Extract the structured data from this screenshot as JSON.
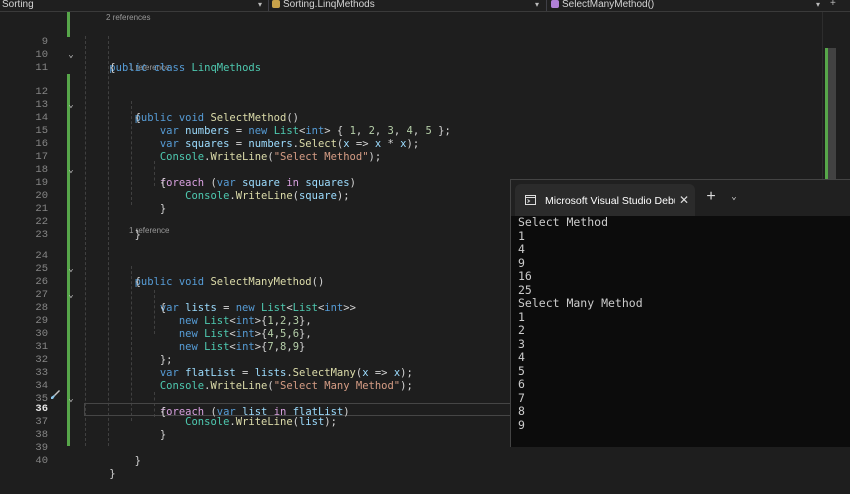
{
  "navbar": {
    "project": "Sorting",
    "class_path": "Sorting.LinqMethods",
    "member": "SelectManyMethod()"
  },
  "code_lens": {
    "class_refs": "2 references",
    "select_refs": "1 reference",
    "selectmany_refs": "1 reference"
  },
  "line_numbers": {
    "l9": "9",
    "l10": "10",
    "l11": "11",
    "l12": "12",
    "l13": "13",
    "l14": "14",
    "l15": "15",
    "l16": "16",
    "l17": "17",
    "l18": "18",
    "l19": "19",
    "l20": "20",
    "l21": "21",
    "l22": "22",
    "l23": "23",
    "l24": "24",
    "l25": "25",
    "l26": "26",
    "l27": "27",
    "l28": "28",
    "l29": "29",
    "l30": "30",
    "l31": "31",
    "l32": "32",
    "l33": "33",
    "l34": "34",
    "l35": "35",
    "l36": "36",
    "l37": "37",
    "l38": "38",
    "l39": "39",
    "l40": "40"
  },
  "code": {
    "public": "public",
    "class": "class",
    "static_void": "void",
    "var": "var",
    "new": "new",
    "foreach": "foreach",
    "in": "in",
    "class_name": "LinqMethods",
    "select_method": "SelectMethod",
    "selectmany_method": "SelectManyMethod",
    "list": "List",
    "int": "int",
    "console": "Console",
    "writeline": "WriteLine",
    "select": "Select",
    "selectmany": "SelectMany",
    "numbers": "numbers",
    "squares": "squares",
    "square": "square",
    "x": "x",
    "lists": "lists",
    "flatList": "flatList",
    "listvar": "list",
    "str_select": "\"Select Method\"",
    "str_selectmany": "\"Select Many Method\"",
    "n1": "1",
    "n2": "2",
    "n3": "3",
    "n4": "4",
    "n5": "5",
    "n6": "6",
    "n7": "7",
    "n8": "8",
    "n9": "9"
  },
  "console": {
    "title": "Microsoft Visual Studio Debug Console",
    "lines": [
      "Select Method",
      "1",
      "4",
      "9",
      "16",
      "25",
      "Select Many Method",
      "1",
      "2",
      "3",
      "4",
      "5",
      "6",
      "7",
      "8",
      "9"
    ]
  },
  "colors": {
    "keyword": "#569cd6",
    "type": "#4ec9b0",
    "method": "#dcdcaa",
    "variable": "#9cdcfe",
    "string": "#d69d85",
    "number": "#b5cea8",
    "change_bar": "#57a64a"
  },
  "icons": {
    "project": "csharp-project-icon",
    "class": "class-icon",
    "member": "method-cube-icon",
    "console": "terminal-icon",
    "quick_actions": "paintbrush-icon"
  }
}
